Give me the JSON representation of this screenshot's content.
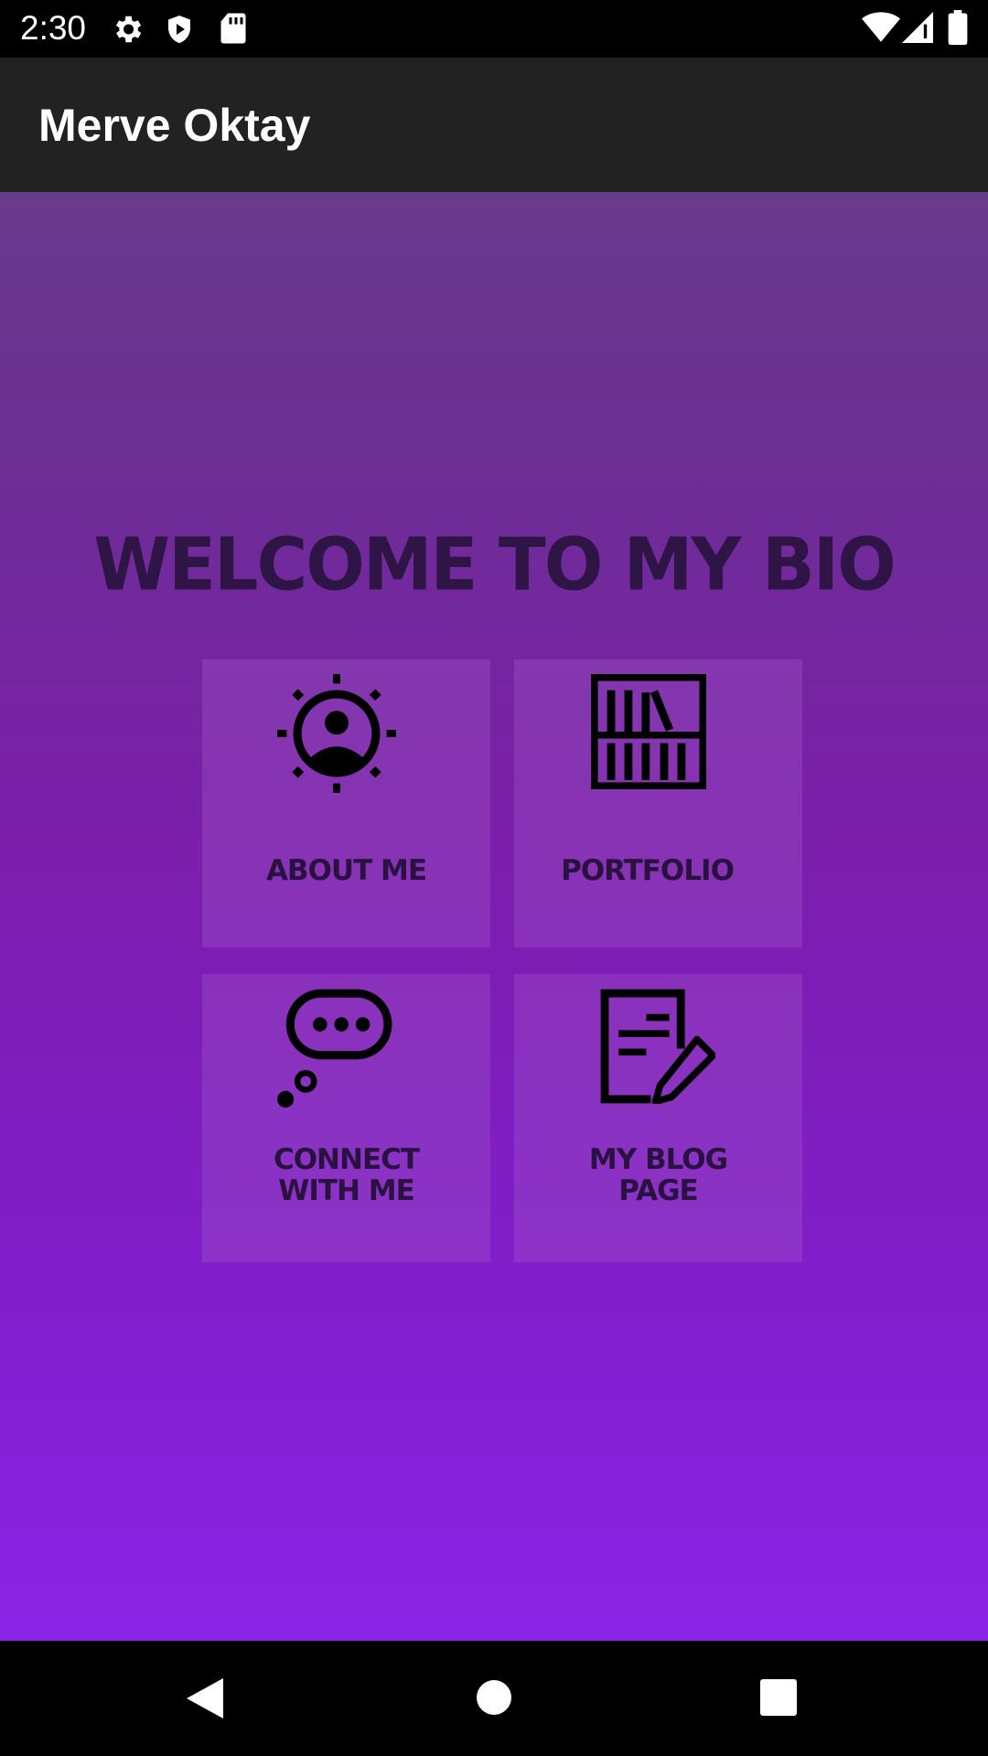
{
  "status_bar": {
    "time": "2:30",
    "icons": [
      "settings-icon",
      "shield-icon",
      "sd-card-icon",
      "wifi-icon",
      "signal-icon",
      "battery-icon"
    ]
  },
  "app_bar": {
    "title": "Merve Oktay"
  },
  "main": {
    "heading": "WELCOME TO MY BIO",
    "tiles": [
      {
        "label": "ABOUT ME",
        "icon": "person-sun-icon"
      },
      {
        "label": "PORTFOLIO",
        "icon": "bookshelf-icon"
      },
      {
        "label_line1": "CONNECT",
        "label_line2": "WITH ME",
        "icon": "speech-bubble-icon"
      },
      {
        "label_line1": "MY BLOG",
        "label_line2": "PAGE",
        "icon": "note-edit-icon"
      }
    ]
  },
  "nav_bar": {
    "buttons": [
      "back-icon",
      "home-icon",
      "recents-icon"
    ]
  },
  "colors": {
    "app_bar": "#222222",
    "gradient_top": "#6a3a8c",
    "gradient_bottom": "#8a25e6",
    "text_dark": "#2e1545"
  }
}
